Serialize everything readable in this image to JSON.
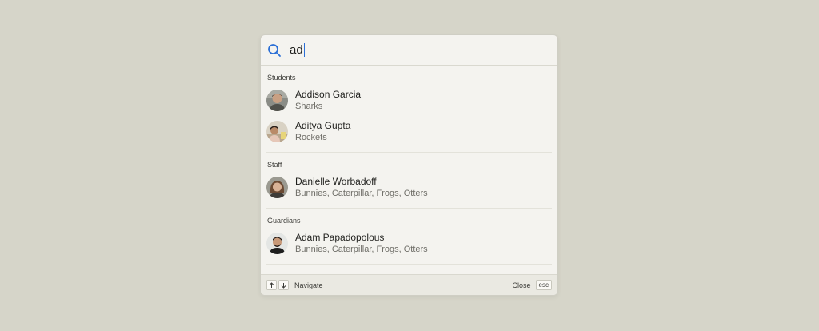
{
  "search": {
    "value": "ad",
    "icon": "search-icon",
    "accent_color": "#2b6fd6"
  },
  "sections": [
    {
      "title": "Students",
      "results": [
        {
          "name": "Addison Garcia",
          "sub": "Sharks"
        },
        {
          "name": "Aditya Gupta",
          "sub": "Rockets"
        }
      ]
    },
    {
      "title": "Staff",
      "results": [
        {
          "name": "Danielle Worbadoff",
          "sub": "Bunnies, Caterpillar, Frogs, Otters"
        }
      ]
    },
    {
      "title": "Guardians",
      "results": [
        {
          "name": "Adam Papadopolous",
          "sub": "Bunnies, Caterpillar, Frogs, Otters"
        }
      ]
    }
  ],
  "footer": {
    "up_key_icon": "arrow-up-icon",
    "down_key_icon": "arrow-down-icon",
    "navigate_label": "Navigate",
    "close_label": "Close",
    "esc_key": "esc"
  }
}
